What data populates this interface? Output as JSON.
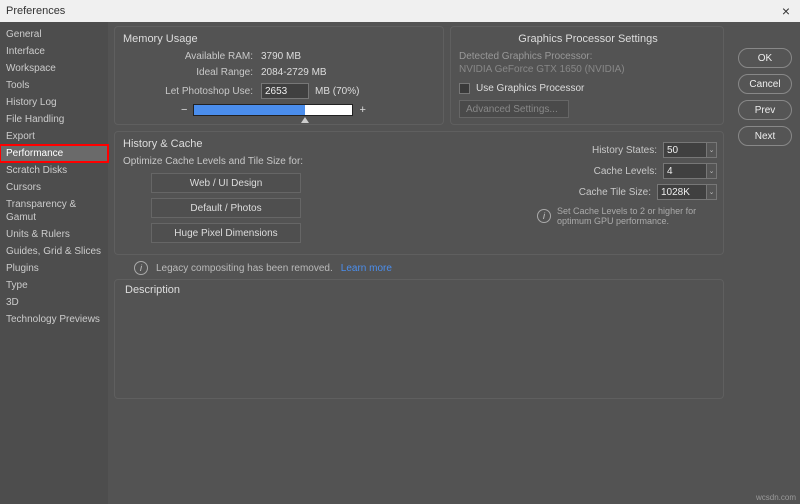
{
  "title": "Preferences",
  "sidebar": {
    "items": [
      {
        "label": "General"
      },
      {
        "label": "Interface"
      },
      {
        "label": "Workspace"
      },
      {
        "label": "Tools"
      },
      {
        "label": "History Log"
      },
      {
        "label": "File Handling"
      },
      {
        "label": "Export"
      },
      {
        "label": "Performance"
      },
      {
        "label": "Scratch Disks"
      },
      {
        "label": "Cursors"
      },
      {
        "label": "Transparency & Gamut"
      },
      {
        "label": "Units & Rulers"
      },
      {
        "label": "Guides, Grid & Slices"
      },
      {
        "label": "Plugins"
      },
      {
        "label": "Type"
      },
      {
        "label": "3D"
      },
      {
        "label": "Technology Previews"
      }
    ]
  },
  "buttons": {
    "ok": "OK",
    "cancel": "Cancel",
    "prev": "Prev",
    "next": "Next"
  },
  "memory": {
    "title": "Memory Usage",
    "avail_label": "Available RAM:",
    "avail_value": "3790 MB",
    "ideal_label": "Ideal Range:",
    "ideal_value": "2084-2729 MB",
    "let_label": "Let Photoshop Use:",
    "let_value": "2653",
    "let_unit": "MB (70%)",
    "minus": "−",
    "plus": "+"
  },
  "gpu": {
    "title": "Graphics Processor Settings",
    "detected_label": "Detected Graphics Processor:",
    "detected_value": "NVIDIA GeForce GTX 1650 (NVIDIA)",
    "use_label": "Use Graphics Processor",
    "adv_label": "Advanced Settings..."
  },
  "history": {
    "title": "History & Cache",
    "optimize_label": "Optimize Cache Levels and Tile Size for:",
    "opt1": "Web / UI Design",
    "opt2": "Default / Photos",
    "opt3": "Huge Pixel Dimensions",
    "states_label": "History States:",
    "states_value": "50",
    "levels_label": "Cache Levels:",
    "levels_value": "4",
    "tile_label": "Cache Tile Size:",
    "tile_value": "1028K",
    "hint": "Set Cache Levels to 2 or higher for optimum GPU performance."
  },
  "legacy": {
    "text": "Legacy compositing has been removed.",
    "link": "Learn more"
  },
  "description": {
    "title": "Description"
  },
  "watermark": "wcsdn.com"
}
